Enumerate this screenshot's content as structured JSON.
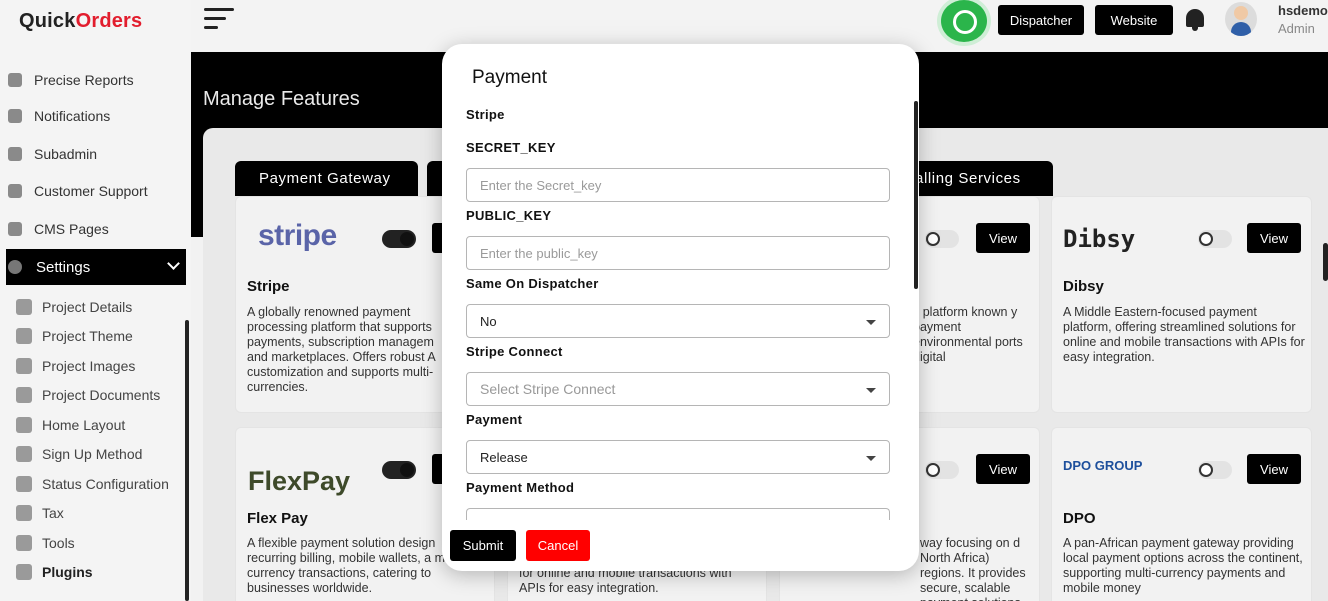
{
  "logo": {
    "part1": "Quick",
    "part2": "Orders"
  },
  "sidebar": {
    "items": [
      {
        "label": "Precise Reports",
        "icon": "report-icon"
      },
      {
        "label": "Notifications",
        "icon": "bell-icon"
      },
      {
        "label": "Subadmin",
        "icon": "users-icon"
      },
      {
        "label": "Customer Support",
        "icon": "chat-icon"
      },
      {
        "label": "CMS Pages",
        "icon": "page-icon"
      }
    ],
    "settings": {
      "label": "Settings",
      "icon": "gear-icon"
    },
    "sub_items": [
      {
        "label": "Project Details",
        "icon": "details-icon"
      },
      {
        "label": "Project Theme",
        "icon": "palette-icon"
      },
      {
        "label": "Project Images",
        "icon": "image-icon"
      },
      {
        "label": "Project Documents",
        "icon": "documents-icon"
      },
      {
        "label": "Home Layout",
        "icon": "home-icon"
      },
      {
        "label": "Sign Up Method",
        "icon": "signup-icon"
      },
      {
        "label": "Status Configuration",
        "icon": "status-icon"
      },
      {
        "label": "Tax",
        "icon": "tax-icon"
      },
      {
        "label": "Tools",
        "icon": "tools-icon"
      },
      {
        "label": "Plugins",
        "icon": "plugin-icon"
      }
    ]
  },
  "header": {
    "dispatcher_label": "Dispatcher",
    "website_label": "Website",
    "username": "hsdemo",
    "role": "Admin"
  },
  "main": {
    "title": "Manage Features",
    "tabs": [
      {
        "label": "Payment Gateway"
      },
      {
        "label": "alling Services"
      }
    ],
    "view_label": "View",
    "cards": [
      {
        "name": "Stripe",
        "brand": "stripe",
        "desc": "A globally renowned payment processing platform that supports payments, subscription managem and marketplaces. Offers robust A customization and supports multi- currencies."
      },
      {
        "name": "",
        "brand": "",
        "desc": "c platform known y payment environmental ports digital"
      },
      {
        "name": "Dibsy",
        "brand": "Dibsy",
        "desc": "A Middle Eastern-focused payment platform, offering streamlined solutions for online and mobile transactions with APIs for easy integration."
      },
      {
        "name": "Flex Pay",
        "brand": "FlexPay",
        "desc": "A flexible payment solution design recurring billing, mobile wallets, a multi-currency transactions, catering to businesses worldwide."
      },
      {
        "name": "",
        "brand": "",
        "desc": "for online and mobile transactions with APIs for easy integration."
      },
      {
        "name": "",
        "brand": "",
        "desc": "way focusing on d North Africa) regions. It provides secure, scalable payment solutions and fraud prevention"
      },
      {
        "name": "DPO",
        "brand": "DPO GROUP",
        "desc": "A pan-African payment gateway providing local payment options across the continent, supporting multi-currency payments and mobile money"
      }
    ]
  },
  "modal": {
    "title": "Payment",
    "section": "Stripe",
    "secret_key": {
      "label": "SECRET_KEY",
      "placeholder": "Enter the Secret_key"
    },
    "public_key": {
      "label": "PUBLIC_KEY",
      "placeholder": "Enter the public_key"
    },
    "same_on_dispatcher": {
      "label": "Same On Dispatcher",
      "value": "No"
    },
    "stripe_connect": {
      "label": "Stripe Connect",
      "placeholder": "Select Stripe Connect"
    },
    "payment": {
      "label": "Payment",
      "value": "Release"
    },
    "payment_method": {
      "label": "Payment Method"
    },
    "submit_label": "Submit",
    "cancel_label": "Cancel"
  }
}
